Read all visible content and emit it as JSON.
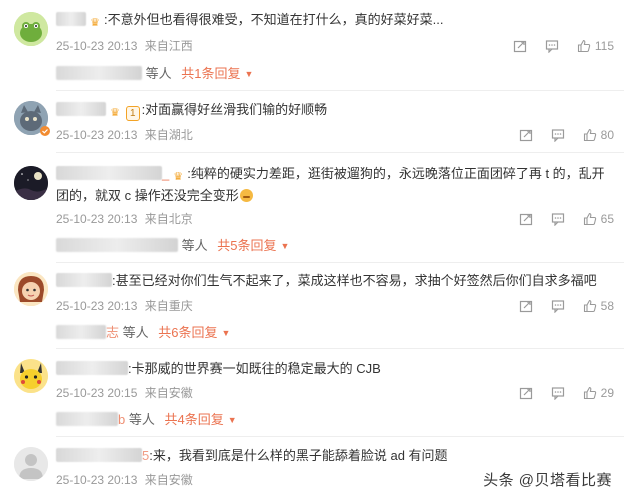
{
  "comments": [
    {
      "text": ":不意外但也看得很难受，不知道在打什么，真的好菜好菜...",
      "timestamp": "25-10-23 20:13",
      "location": "来自江西",
      "likes": "115",
      "reply_suffix": "等人",
      "reply_count": "共1条回复"
    },
    {
      "text": ":对面赢得好丝滑我们输的好顺畅",
      "timestamp": "25-10-23 20:13",
      "location": "来自湖北",
      "likes": "80",
      "level": "1"
    },
    {
      "text": ":纯粹的硬实力差距，逛街被遛狗的，永远晚落位正面团碎了再 t 的，乱开团的，就双 c 操作还没完全变形",
      "timestamp": "25-10-23 20:13",
      "location": "来自北京",
      "likes": "65",
      "reply_suffix": "等人",
      "reply_count": "共5条回复"
    },
    {
      "text": ":甚至已经对你们生气不起来了，菜成这样也不容易，求抽个好签然后你们自求多福吧",
      "timestamp": "25-10-23 20:13",
      "location": "来自重庆",
      "likes": "58",
      "reply_suffix": "等人",
      "reply_count": "共6条回复",
      "reply_name_tail": "志"
    },
    {
      "text": ":卡那威的世界赛一如既往的稳定最大的 CJB",
      "timestamp": "25-10-23 20:15",
      "location": "来自安徽",
      "likes": "29",
      "reply_suffix": "等人",
      "reply_count": "共4条回复",
      "reply_name_tail": "b"
    },
    {
      "text": ":来，我看到底是什么样的黑子能舔着脸说 ad 有问题",
      "timestamp": "25-10-23 20:13",
      "location": "来自安徽",
      "name_tail": "5"
    }
  ],
  "watermark": "头条 @贝塔看比赛",
  "icons": {
    "share": "share-icon",
    "comment": "comment-icon",
    "like": "like-icon",
    "crown": "crown-icon"
  },
  "colors": {
    "accent": "#eb7350",
    "meta": "#999999",
    "text": "#333333"
  }
}
